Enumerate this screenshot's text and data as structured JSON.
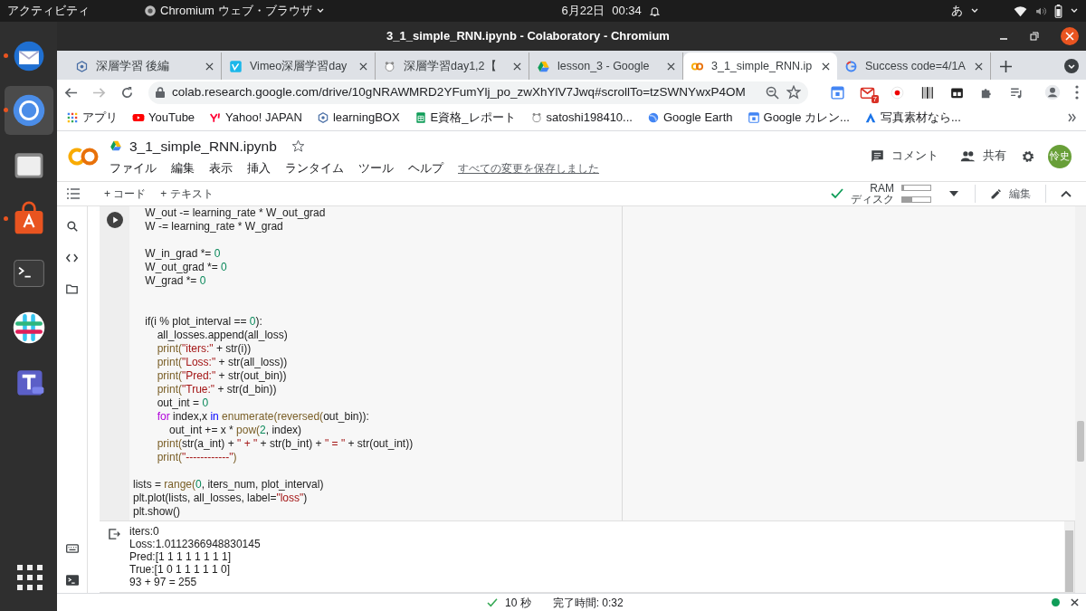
{
  "system_bar": {
    "activities": "アクティビティ",
    "app_menu": "Chromium ウェブ・ブラウザ",
    "date": "6月22日",
    "time": "00:34",
    "input_method": "あ"
  },
  "dock": [
    {
      "kind": "mail",
      "running": true,
      "selected": false
    },
    {
      "kind": "browser",
      "running": true,
      "selected": true
    },
    {
      "kind": "files",
      "running": false,
      "selected": false
    },
    {
      "kind": "store",
      "running": true,
      "selected": false
    },
    {
      "kind": "terminal",
      "running": false,
      "selected": false
    },
    {
      "kind": "chat",
      "running": false,
      "selected": false
    },
    {
      "kind": "teams",
      "running": false,
      "selected": false
    }
  ],
  "window": {
    "title": "3_1_simple_RNN.ipynb - Colaboratory - Chromium"
  },
  "tabs": [
    {
      "title": "深層学習 後編",
      "kind": "badge",
      "selected": false
    },
    {
      "title": "Vimeo深層学習day",
      "kind": "vimeo",
      "selected": false
    },
    {
      "title": "深層学習day1,2【",
      "kind": "bear",
      "selected": false
    },
    {
      "title": "lesson_3 - Google",
      "kind": "drive",
      "selected": false
    },
    {
      "title": "3_1_simple_RNN.ip",
      "kind": "colab",
      "selected": true
    },
    {
      "title": "Success code=4/1A",
      "kind": "google",
      "selected": false
    }
  ],
  "address_bar": {
    "url": "colab.research.google.com/drive/10gNRAWMRD2YFumYlj_po_zwXhYlV7Jwq#scrollTo=tzSWNYwxP4OM",
    "starred": false
  },
  "extensions": [
    {
      "kind": "calendar"
    },
    {
      "kind": "gmail",
      "badge": "7"
    },
    {
      "kind": "record"
    },
    {
      "kind": "barcode"
    },
    {
      "kind": "tabs"
    },
    {
      "kind": "puzzle"
    },
    {
      "kind": "playlist"
    }
  ],
  "bookmarks": [
    {
      "title": "アプリ",
      "kind": "apps"
    },
    {
      "title": "YouTube",
      "kind": "youtube"
    },
    {
      "title": "Yahoo! JAPAN",
      "kind": "yahoo"
    },
    {
      "title": "learningBOX",
      "kind": "badge"
    },
    {
      "title": "E資格_レポート",
      "kind": "sheets"
    },
    {
      "title": "satoshi198410...",
      "kind": "bear"
    },
    {
      "title": "Google Earth",
      "kind": "earth"
    },
    {
      "title": "Google カレン...",
      "kind": "calendar"
    },
    {
      "title": "写真素材なら...",
      "kind": "triangle"
    }
  ],
  "notebook": {
    "file_name": "3_1_simple_RNN.ipynb",
    "starred": false,
    "menus": [
      "ファイル",
      "編集",
      "表示",
      "挿入",
      "ランタイム",
      "ツール",
      "ヘルプ"
    ],
    "save_status": "すべての変更を保存しました",
    "comment": "コメント",
    "share": "共有",
    "avatar": "怜史",
    "add_code": "+ コード",
    "add_text": "+ テキスト",
    "edit": "編集"
  },
  "runtime": {
    "connected": true,
    "ram_label": "RAM",
    "disk_label": "ディスク",
    "ram": {
      "level": 0.06
    },
    "disk": {
      "level": 0.35
    }
  },
  "cell": {
    "lines": [
      {
        "kind": "code",
        "tokens": [
          {
            "t": "    W_out -= learning_rate * W_out_grad",
            "kind": "plain"
          }
        ]
      },
      {
        "kind": "code",
        "tokens": [
          {
            "t": "    W -= learning_rate * W_grad",
            "kind": "plain"
          }
        ]
      },
      {
        "kind": "blank"
      },
      {
        "kind": "code",
        "tokens": [
          {
            "t": "    W_in_grad *= ",
            "kind": "plain"
          },
          {
            "t": "0",
            "kind": "number"
          }
        ]
      },
      {
        "kind": "code",
        "tokens": [
          {
            "t": "    W_out_grad *= ",
            "kind": "plain"
          },
          {
            "t": "0",
            "kind": "number"
          }
        ]
      },
      {
        "kind": "code",
        "tokens": [
          {
            "t": "    W_grad *= ",
            "kind": "plain"
          },
          {
            "t": "0",
            "kind": "number"
          }
        ]
      },
      {
        "kind": "blank"
      },
      {
        "kind": "blank"
      },
      {
        "kind": "code",
        "tokens": [
          {
            "t": "    if(i % plot_interval == ",
            "kind": "plain"
          },
          {
            "t": "0",
            "kind": "number"
          },
          {
            "t": "):",
            "kind": "plain"
          }
        ]
      },
      {
        "kind": "code",
        "tokens": [
          {
            "t": "        all_losses.append(all_loss)",
            "kind": "plain"
          }
        ]
      },
      {
        "kind": "code",
        "tokens": [
          {
            "t": "        print(",
            "kind": "builtin"
          },
          {
            "t": "\"iters:\"",
            "kind": "string"
          },
          {
            "t": " + str(i))",
            "kind": "plain"
          }
        ]
      },
      {
        "kind": "code",
        "tokens": [
          {
            "t": "        print(",
            "kind": "builtin"
          },
          {
            "t": "\"Loss:\"",
            "kind": "string"
          },
          {
            "t": " + str(all_loss))",
            "kind": "plain"
          }
        ]
      },
      {
        "kind": "code",
        "tokens": [
          {
            "t": "        print(",
            "kind": "builtin"
          },
          {
            "t": "\"Pred:\"",
            "kind": "string"
          },
          {
            "t": " + str(out_bin))",
            "kind": "plain"
          }
        ]
      },
      {
        "kind": "code",
        "tokens": [
          {
            "t": "        print(",
            "kind": "builtin"
          },
          {
            "t": "\"True:\"",
            "kind": "string"
          },
          {
            "t": " + str(d_bin))",
            "kind": "plain"
          }
        ]
      },
      {
        "kind": "code",
        "tokens": [
          {
            "t": "        out_int = ",
            "kind": "plain"
          },
          {
            "t": "0",
            "kind": "number"
          }
        ]
      },
      {
        "kind": "code",
        "tokens": [
          {
            "t": "        for",
            "kind": "control"
          },
          {
            "t": " index,x ",
            "kind": "plain"
          },
          {
            "t": "in",
            "kind": "operator"
          },
          {
            "t": " enumerate(reversed(",
            "kind": "builtin"
          },
          {
            "t": "out_bin)):",
            "kind": "plain"
          }
        ]
      },
      {
        "kind": "code",
        "tokens": [
          {
            "t": "            out_int += x * ",
            "kind": "plain"
          },
          {
            "t": "pow(",
            "kind": "builtin"
          },
          {
            "t": "2",
            "kind": "number"
          },
          {
            "t": ", index)",
            "kind": "plain"
          }
        ]
      },
      {
        "kind": "code",
        "tokens": [
          {
            "t": "        print(",
            "kind": "builtin"
          },
          {
            "t": "str(a_int) + ",
            "kind": "plain"
          },
          {
            "t": "\" + \"",
            "kind": "string"
          },
          {
            "t": " + str(b_int) + ",
            "kind": "plain"
          },
          {
            "t": "\" = \"",
            "kind": "string"
          },
          {
            "t": " + str(out_int))",
            "kind": "plain"
          }
        ]
      },
      {
        "kind": "code",
        "tokens": [
          {
            "t": "        print(",
            "kind": "builtin"
          },
          {
            "t": "\"------------\"",
            "kind": "string"
          },
          {
            "t": ")",
            "kind": "builtin"
          }
        ]
      },
      {
        "kind": "blank"
      },
      {
        "kind": "code",
        "tokens": [
          {
            "t": "lists = ",
            "kind": "plain"
          },
          {
            "t": "range(",
            "kind": "builtin"
          },
          {
            "t": "0",
            "kind": "number"
          },
          {
            "t": ", iters_num, plot_interval)",
            "kind": "plain"
          }
        ]
      },
      {
        "kind": "code",
        "tokens": [
          {
            "t": "plt.plot(lists, all_losses, label=",
            "kind": "plain"
          },
          {
            "t": "\"loss\"",
            "kind": "string"
          },
          {
            "t": ")",
            "kind": "plain"
          }
        ]
      },
      {
        "kind": "code",
        "tokens": [
          {
            "t": "plt.show()",
            "kind": "plain"
          }
        ]
      }
    ],
    "output": [
      "iters:0",
      "Loss:1.0112366948830145",
      "Pred:[1 1 1 1 1 1 1 1]",
      "True:[1 0 1 1 1 1 1 0]",
      "93 + 97 = 255"
    ]
  },
  "status_bar": {
    "duration": "10 秒",
    "finished": "完了時間: 0:32",
    "connected": true
  }
}
